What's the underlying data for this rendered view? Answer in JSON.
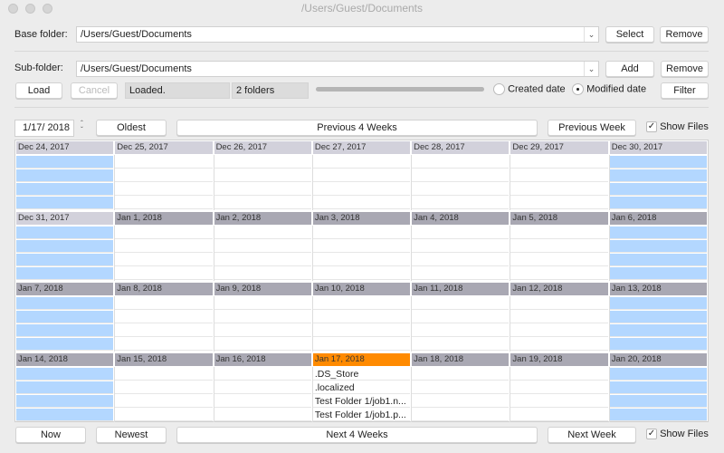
{
  "window": {
    "title": "/Users/Guest/Documents"
  },
  "base": {
    "label": "Base folder:",
    "value": "/Users/Guest/Documents",
    "select": "Select",
    "remove": "Remove"
  },
  "sub": {
    "label": "Sub-folder:",
    "value": "/Users/Guest/Documents",
    "add": "Add",
    "remove": "Remove"
  },
  "status": {
    "load": "Load",
    "cancel": "Cancel",
    "message": "Loaded.",
    "count": "2 folders",
    "progress": 1.0,
    "created": "Created date",
    "modified": "Modified date",
    "filter": "Filter",
    "date_mode": "modified"
  },
  "nav_top": {
    "date": "1/17/ 2018",
    "oldest": "Oldest",
    "prev4": "Previous 4 Weeks",
    "prev_week": "Previous Week",
    "show_files": "Show Files",
    "show_files_checked": true
  },
  "nav_bottom": {
    "now": "Now",
    "newest": "Newest",
    "next4": "Next 4 Weeks",
    "next_week": "Next Week",
    "show_files": "Show Files",
    "show_files_checked": true
  },
  "colors": {
    "weekend": "#b3d7ff",
    "today": "#ff8a00",
    "header_first": "#d2d1db",
    "header": "#a9a8b3"
  },
  "weeks": [
    {
      "days": [
        {
          "label": "Dec 24, 2017"
        },
        {
          "label": "Dec 25, 2017"
        },
        {
          "label": "Dec 26, 2017"
        },
        {
          "label": "Dec 27, 2017"
        },
        {
          "label": "Dec 28, 2017"
        },
        {
          "label": "Dec 29, 2017"
        },
        {
          "label": "Dec 30, 2017"
        }
      ]
    },
    {
      "days": [
        {
          "label": "Dec 31, 2017",
          "light": true
        },
        {
          "label": "Jan 1, 2018"
        },
        {
          "label": "Jan 2, 2018"
        },
        {
          "label": "Jan 3, 2018"
        },
        {
          "label": "Jan 4, 2018"
        },
        {
          "label": "Jan 5, 2018"
        },
        {
          "label": "Jan 6, 2018"
        }
      ]
    },
    {
      "days": [
        {
          "label": "Jan 7, 2018"
        },
        {
          "label": "Jan 8, 2018"
        },
        {
          "label": "Jan 9, 2018"
        },
        {
          "label": "Jan 10, 2018"
        },
        {
          "label": "Jan 11, 2018"
        },
        {
          "label": "Jan 12, 2018"
        },
        {
          "label": "Jan 13, 2018"
        }
      ]
    },
    {
      "days": [
        {
          "label": "Jan 14, 2018"
        },
        {
          "label": "Jan 15, 2018"
        },
        {
          "label": "Jan 16, 2018"
        },
        {
          "label": "Jan 17, 2018",
          "today": true,
          "files": [
            ".DS_Store",
            ".localized",
            "Test Folder 1/job1.n...",
            "Test Folder 1/job1.p..."
          ]
        },
        {
          "label": "Jan 18, 2018"
        },
        {
          "label": "Jan 19, 2018"
        },
        {
          "label": "Jan 20, 2018"
        }
      ]
    }
  ]
}
